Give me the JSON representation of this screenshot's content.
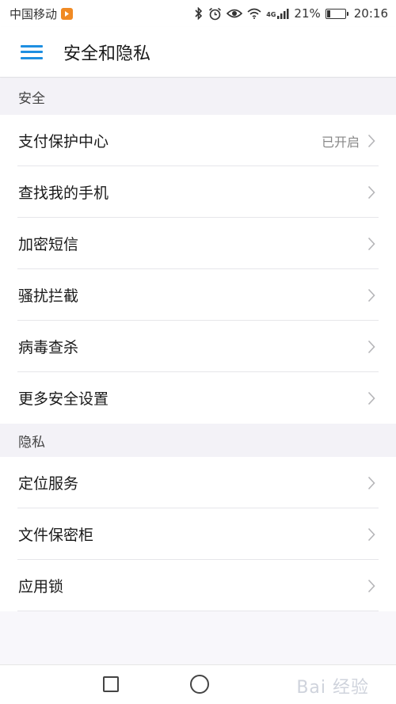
{
  "status_bar": {
    "carrier": "中国移动",
    "network": "4G",
    "battery_percent": "21%",
    "battery_level": 0.21,
    "time": "20:16"
  },
  "app_bar": {
    "title": "安全和隐私"
  },
  "sections": [
    {
      "header": "安全",
      "items": [
        {
          "label": "支付保护中心",
          "value": "已开启"
        },
        {
          "label": "查找我的手机",
          "value": ""
        },
        {
          "label": "加密短信",
          "value": ""
        },
        {
          "label": "骚扰拦截",
          "value": ""
        },
        {
          "label": "病毒查杀",
          "value": ""
        },
        {
          "label": "更多安全设置",
          "value": ""
        }
      ]
    },
    {
      "header": "隐私",
      "items": [
        {
          "label": "定位服务",
          "value": ""
        },
        {
          "label": "文件保密柜",
          "value": ""
        },
        {
          "label": "应用锁",
          "value": ""
        }
      ]
    }
  ],
  "watermark": "Bai 经验",
  "colors": {
    "accent": "#1e8fe1",
    "carrier_badge": "#f08a24",
    "background": "#f8f7fb",
    "section_header_bg": "#f3f2f7"
  }
}
